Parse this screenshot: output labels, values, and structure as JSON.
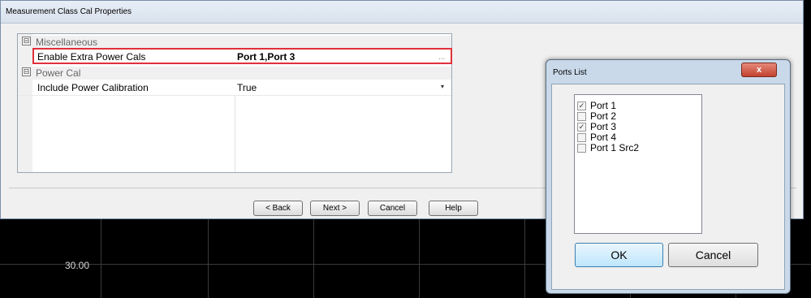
{
  "main_dialog": {
    "title": "Measurement Class Cal Properties",
    "grid": {
      "categories": [
        {
          "label": "Miscellaneous",
          "toggle": "⊟"
        },
        {
          "label": "Power Cal",
          "toggle": "⊟"
        }
      ],
      "properties": [
        {
          "name": "Enable Extra Power Cals",
          "value": "Port 1,Port 3",
          "editor": "..."
        },
        {
          "name": "Include Power Calibration",
          "value": "True",
          "editor": "▾"
        }
      ]
    },
    "buttons": {
      "back": "< Back",
      "next": "Next >",
      "cancel": "Cancel",
      "help": "Help"
    },
    "highlight_color": "#e0313a"
  },
  "graph": {
    "y_label": "30.00"
  },
  "ports_dialog": {
    "title": "Ports List",
    "close_label": "x",
    "items": [
      {
        "label": "Port 1",
        "checked": true,
        "mark": "✓"
      },
      {
        "label": "Port 2",
        "checked": false,
        "mark": ""
      },
      {
        "label": "Port 3",
        "checked": true,
        "mark": "✓"
      },
      {
        "label": "Port 4",
        "checked": false,
        "mark": ""
      },
      {
        "label": "Port 1 Src2",
        "checked": false,
        "mark": ""
      }
    ],
    "ok_label": "OK",
    "cancel_label": "Cancel"
  }
}
